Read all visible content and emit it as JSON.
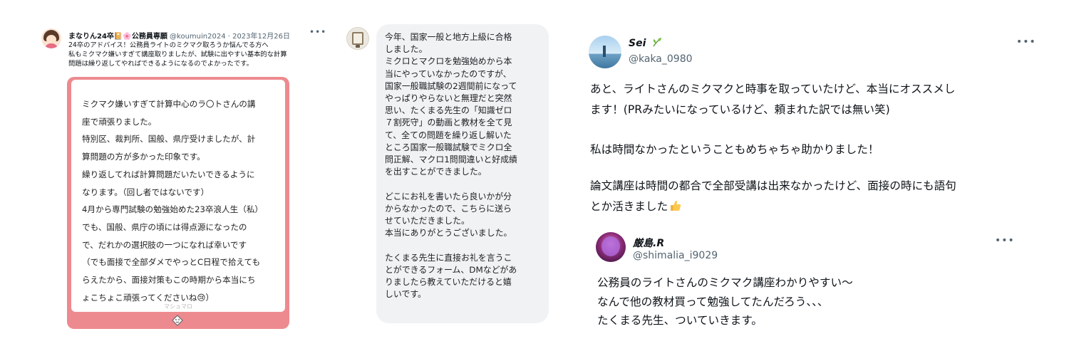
{
  "panel1": {
    "name": "まなりん24卒📔🌸公務員専願",
    "handle": "@koumuin2024 · 2023年12月26日",
    "more_icon": "more-dots-icon",
    "tweet_lines": [
      "24卒のアドバイス！公務員ライトのミクマク取ろうか悩んでる方へ",
      "私もミクマク嫌いすぎて講座取りましたが、試験に出やすい基本的な計算",
      "問題は繰り返してやればできるようになるのでよかったです。"
    ],
    "card_lines": [
      "ミクマク嫌いすぎて計算中心のラ〇トさんの講",
      "座で頑張りました。",
      "特別区、裁判所、国般、県庁受けましたが、計",
      "算問題の方が多かった印象です。",
      "繰り返してれば計算問題だいたいできるように",
      "なります。（回し者ではないです）",
      "4月から専門試験の勉強始めた23卒浪人生（私）",
      "でも、国般、県庁の頃には得点源になったの",
      "で、だれかの選択肢の一つになれば幸いです",
      "（でも面接で全部ダメでやっとC日程で拾えても",
      "らえたから、面接対策もこの時期から本当にち",
      "ょこちょこ頑張ってくださいね😢）"
    ],
    "card_brand": "マシュマロ",
    "card_color": "#ed8a8f"
  },
  "panel2": {
    "bubble_lines": [
      "今年、国家一般と地方上級に合格",
      "しました。",
      "ミクロとマクロを勉強始めから本",
      "当にやっていなかったのですが、",
      "国家一般職試験の2週間前になって",
      "やっぱりやらないと無理だと突然",
      "思い、たくまる先生の「知識ゼロ",
      "７割死守」の動画と教材を全て見",
      "て、全ての問題を繰り返し解いた",
      "ところ国家一般職試験でミクロ全",
      "問正解、マクロ1問間違いと好成績",
      "を出すことができました。",
      "",
      "どこにお礼を書いたら良いかが分",
      "からなかったので、こちらに送ら",
      "せていただきました。",
      "本当にありがとうございました。",
      "",
      "たくまる先生に直接お礼を言うこ",
      "とができるフォーム、DMなどがあ",
      "りましたら教えていただけると嬉",
      "しいです。"
    ],
    "bubble_color": "#f1f2f4"
  },
  "panel3": {
    "name": "Sei",
    "name_icon": "leaf-sprout-icon",
    "handle": "@kaka_0980",
    "more_icon": "more-dots-icon",
    "para1": [
      "あと、ライトさんのミクマクと時事を取っていたけど、本当にオススメし",
      "ます！(PRみたいになっているけど、頼まれた訳では無い笑)"
    ],
    "para2": [
      "私は時間なかったということもめちゃちゃ助かりました！"
    ],
    "para3": [
      "論文講座は時間の都合で全部受講は出来なかったけど、面接の時にも語句",
      "とか活きました"
    ],
    "para3_icon": "thumbs-up-icon",
    "quote": {
      "name": "厳島.R",
      "handle": "@shimalia_i9029",
      "more_icon": "more-dots-icon",
      "lines": [
        "公務員のライトさんのミクマク講座わかりやすい〜",
        "なんで他の教材買って勉強してたんだろう、、、",
        "たくまる先生、ついていきます。"
      ]
    }
  }
}
